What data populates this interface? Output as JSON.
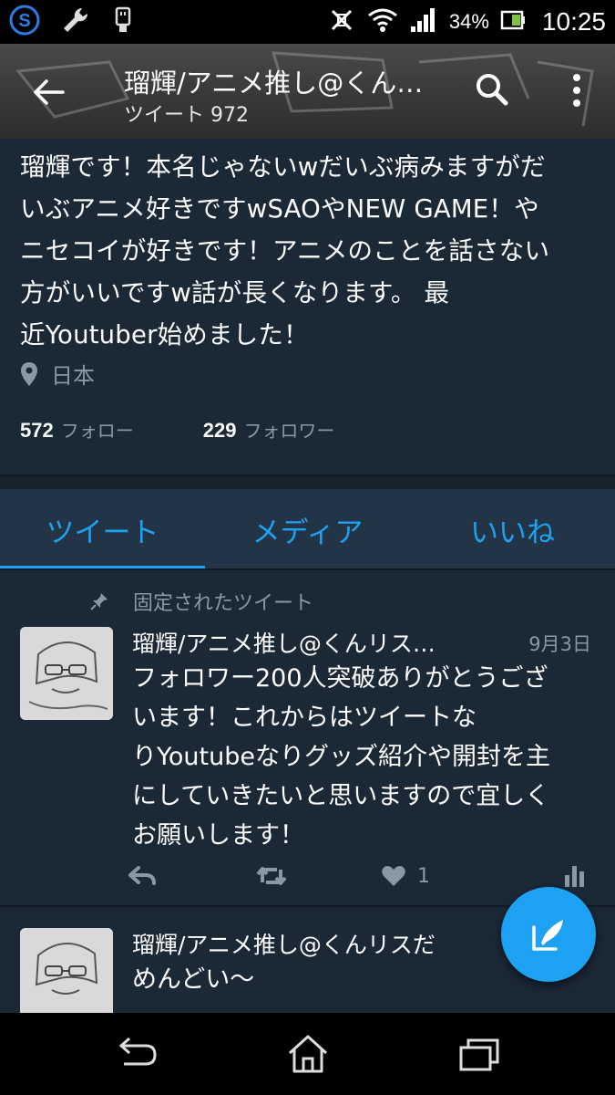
{
  "status_bar": {
    "battery_percent": "34%",
    "time": "10:25",
    "icons": [
      "sync-s-icon",
      "wrench-icon",
      "usb-icon",
      "vibrate-off-icon",
      "wifi-icon",
      "signal-icon",
      "battery-icon"
    ]
  },
  "header": {
    "title": "瑠輝/アニメ推し@くん…",
    "subtitle": "ツイート 972"
  },
  "profile": {
    "bio_lines": [
      "瑠輝です！本名じゃないwだいぶ病みますがだ",
      "いぶアニメ好きですwSAOやNEW GAME！や",
      "ニセコイが好きです！アニメのことを話さない",
      "方がいいですw話が長くなります。 最",
      "近Youtuber始めました！"
    ],
    "location": "日本",
    "following_count": "572",
    "following_label": "フォロー",
    "followers_count": "229",
    "followers_label": "フォロワー"
  },
  "tabs": [
    {
      "label": "ツイート",
      "active": true
    },
    {
      "label": "メディア",
      "active": false
    },
    {
      "label": "いいね",
      "active": false
    }
  ],
  "pinned_label": "固定されたツイート",
  "tweets": [
    {
      "name": "瑠輝/アニメ推し@くんリス…",
      "date": "9月3日",
      "text_lines": [
        "フォロワー200人突破ありがとうござ",
        "います！これからはツイートな",
        "りYoutubeなりグッズ紹介や開封を主",
        "にしていきたいと思いますので宜しく",
        "お願いします！"
      ],
      "like_count": "1"
    },
    {
      "name": "瑠輝/アニメ推し@くんリスだ",
      "text_lines": [
        "めんどい〜"
      ]
    }
  ],
  "colors": {
    "background": "#1b2836",
    "accent": "#1da1f2",
    "muted": "#8899a6",
    "tab_bar": "#243447"
  }
}
